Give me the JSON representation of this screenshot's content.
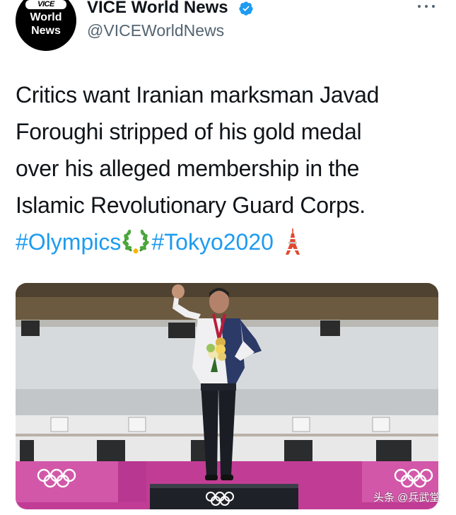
{
  "author": {
    "avatar_logo_text": "VICE",
    "avatar_line1": "World",
    "avatar_line2": "News",
    "display_name": "VICE World News",
    "handle": "@VICEWorldNews",
    "verified_icon": "verified-badge-icon",
    "verified_color": "#1d9bf0"
  },
  "tweet": {
    "text_lines": [
      "Critics want Iranian marksman Javad",
      "Foroughi stripped of his gold medal",
      "over his alleged membership in the",
      "Islamic Revolutionary Guard Corps."
    ],
    "hashtags": [
      "#Olympics",
      "#Tokyo2020"
    ],
    "emojis": [
      "olympic-wreath-emoji",
      "tokyo-tower-emoji"
    ],
    "link_color": "#1d9bf0"
  },
  "media": {
    "image_icon": "olympic-rings-icon",
    "scene": "medal-podium-photo"
  },
  "overflow_menu_icon": "more-dots-icon",
  "watermark": "头条 @兵武堂"
}
